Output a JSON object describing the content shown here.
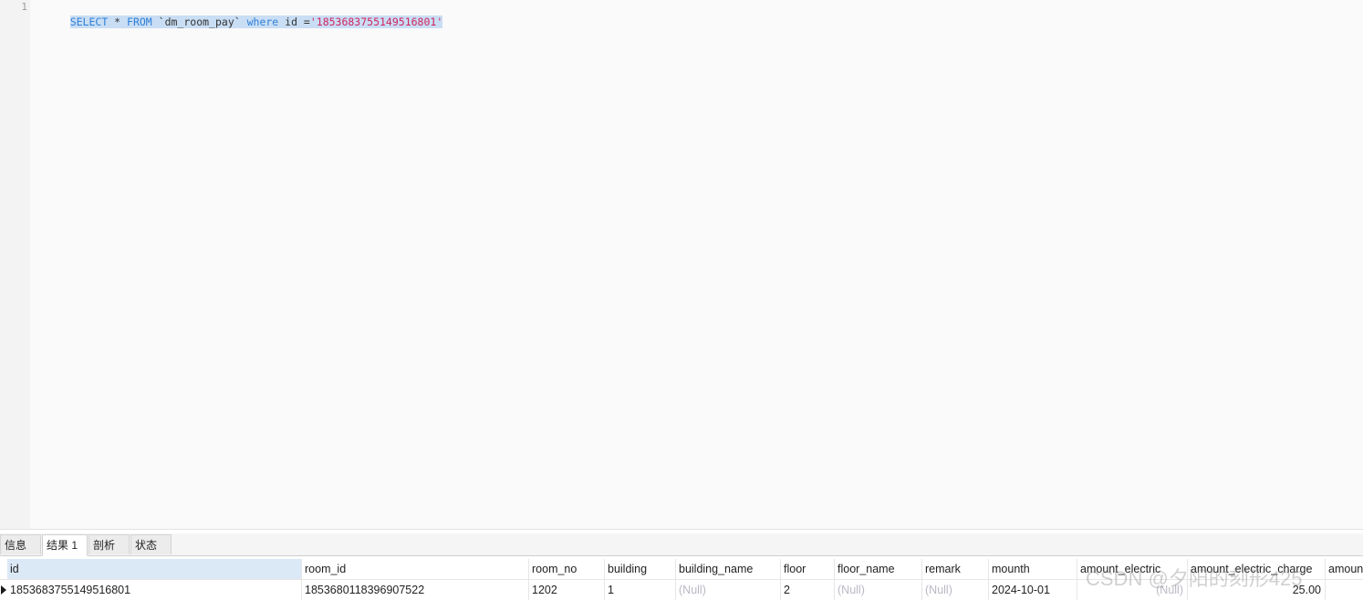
{
  "editor": {
    "line_number": "1",
    "sql": {
      "kw_select": "SELECT",
      "star": " * ",
      "kw_from": "FROM",
      "table": " `dm_room_pay` ",
      "kw_where": "where",
      "condition": " id =",
      "value": "'1853683755149516801'"
    }
  },
  "result_tabs": [
    {
      "label": "信息"
    },
    {
      "label": "结果 1"
    },
    {
      "label": "剖析"
    },
    {
      "label": "状态"
    }
  ],
  "grid": {
    "columns": [
      "id",
      "room_id",
      "room_no",
      "building",
      "building_name",
      "floor",
      "floor_name",
      "remark",
      "mounth",
      "amount_electric",
      "amount_electric_charge",
      "amoun"
    ],
    "rows": [
      [
        "1853683755149516801",
        "1853680118396907522",
        "1202",
        "1",
        "(Null)",
        "2",
        "(Null)",
        "(Null)",
        "2024-10-01",
        "(Null)",
        "25.00",
        ""
      ]
    ]
  },
  "watermark": "CSDN @夕阳的刻形425",
  "colors": {
    "keyword": "#2f7fd8",
    "string": "#d2245f",
    "selection": "#c9def4",
    "null_text": "#b9b9c4"
  }
}
